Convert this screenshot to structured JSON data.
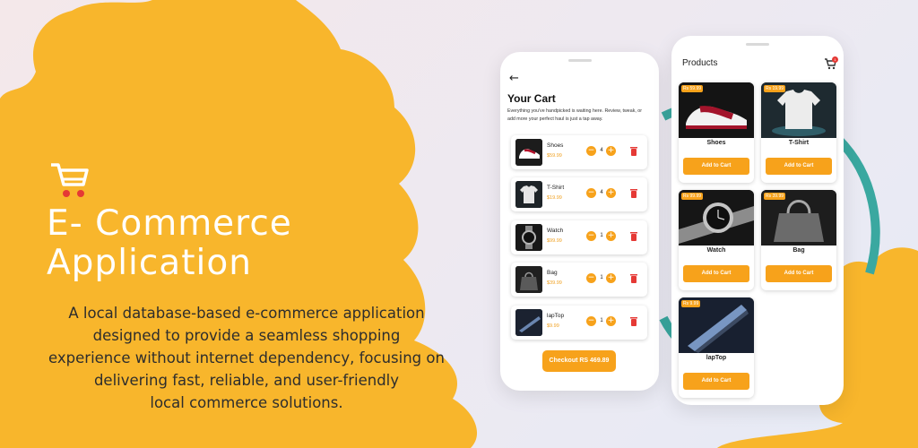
{
  "promo": {
    "headline_line1": "E- Commerce",
    "headline_line2": "Application",
    "description_lines": [
      "A local database-based e-commerce application",
      "designed to provide a seamless shopping",
      "experience without internet dependency, focusing on",
      "delivering fast, reliable, and user-friendly",
      "local commerce solutions."
    ],
    "icon": "shopping-cart-icon",
    "colors": {
      "accent_yellow": "#f8b62c",
      "accent_red": "#e53935",
      "teal_ring": "#3aa8a0"
    }
  },
  "cart_screen": {
    "back_icon": "arrow-left-icon",
    "title": "Your Cart",
    "subtitle": "Everything you've handpicked is waiting here. Review, tweak, or add more your perfect haul is just a tap away.",
    "items": [
      {
        "name": "Shoes",
        "price": "$59.99",
        "qty": "4"
      },
      {
        "name": "T-Shirt",
        "price": "$19.99",
        "qty": "4"
      },
      {
        "name": "Watch",
        "price": "$99.99",
        "qty": "1"
      },
      {
        "name": "Bag",
        "price": "$39.99",
        "qty": "1"
      },
      {
        "name": "lapTop",
        "price": "$9.99",
        "qty": "1"
      }
    ],
    "checkout_label": "Checkout RS 469.89"
  },
  "products_screen": {
    "title": "Products",
    "cart_badge": "1",
    "add_label": "Add to Cart",
    "products": [
      {
        "name": "Shoes",
        "price": "Rs 59.99"
      },
      {
        "name": "T-Shirt",
        "price": "Rs 19.99"
      },
      {
        "name": "Watch",
        "price": "Rs 99.99"
      },
      {
        "name": "Bag",
        "price": "Rs 39.99"
      },
      {
        "name": "lapTop",
        "price": "Rs 9.99"
      }
    ]
  }
}
